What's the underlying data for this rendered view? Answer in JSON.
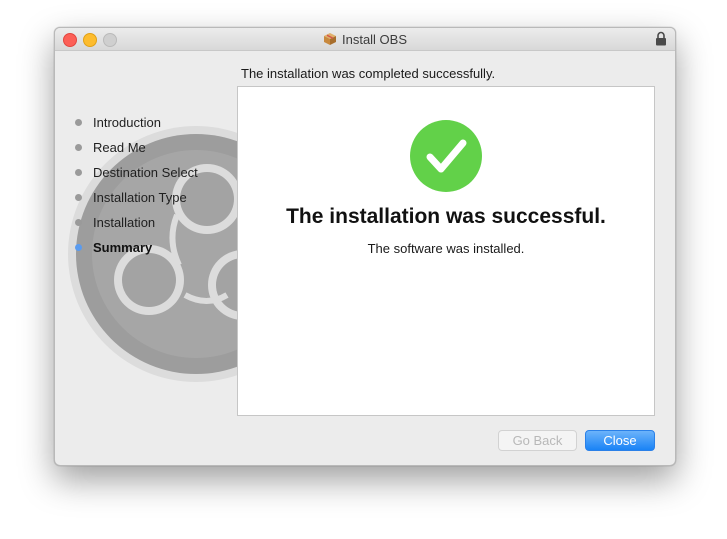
{
  "window": {
    "title": "Install OBS",
    "title_icon": "package-icon",
    "lock_icon": "lock-icon"
  },
  "header": {
    "text": "The installation was completed successfully."
  },
  "steps": [
    {
      "label": "Introduction",
      "active": false
    },
    {
      "label": "Read Me",
      "active": false
    },
    {
      "label": "Destination Select",
      "active": false
    },
    {
      "label": "Installation Type",
      "active": false
    },
    {
      "label": "Installation",
      "active": false
    },
    {
      "label": "Summary",
      "active": true
    }
  ],
  "content": {
    "icon": "checkmark-icon",
    "title": "The installation was successful.",
    "subtitle": "The software was installed."
  },
  "buttons": {
    "back_label": "Go Back",
    "close_label": "Close"
  },
  "colors": {
    "success_green": "#62d149",
    "accent_blue": "#1a83f6",
    "active_step_dot": "#5a9bef"
  }
}
